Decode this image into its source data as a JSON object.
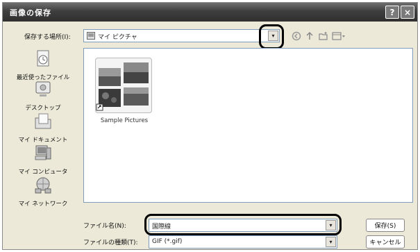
{
  "window": {
    "title": "画像の保存"
  },
  "titlebar": {
    "help_label": "?",
    "close_label": "×"
  },
  "savein": {
    "label": "保存する場所(I):",
    "value": "マイ ピクチャ",
    "arrow": "▾"
  },
  "toolbar": {
    "icons": [
      "back-icon",
      "up-folder-icon",
      "new-folder-icon",
      "view-menu-icon"
    ]
  },
  "places": [
    {
      "label": "最近使ったファイル",
      "icon": "recent-docs-icon"
    },
    {
      "label": "デスクトップ",
      "icon": "desktop-icon"
    },
    {
      "label": "マイ ドキュメント",
      "icon": "my-documents-icon"
    },
    {
      "label": "マイ コンピュータ",
      "icon": "my-computer-icon"
    },
    {
      "label": "マイ ネットワーク",
      "icon": "my-network-icon"
    }
  ],
  "files": [
    {
      "label": "Sample Pictures",
      "icon": "folder-thumbnail-icon"
    }
  ],
  "filename": {
    "label": "ファイル名(N):",
    "value": "国際線",
    "arrow": "▾"
  },
  "filetype": {
    "label": "ファイルの種類(T):",
    "value": "GIF (*.gif)",
    "arrow": "▾"
  },
  "buttons": {
    "save": "保存(S)",
    "cancel": "キャンセル"
  },
  "colors": {
    "titlebar": "#3e3e3e",
    "dialog": "#ece9d8",
    "field_border": "#7f9db9",
    "highlight": "#000000"
  }
}
